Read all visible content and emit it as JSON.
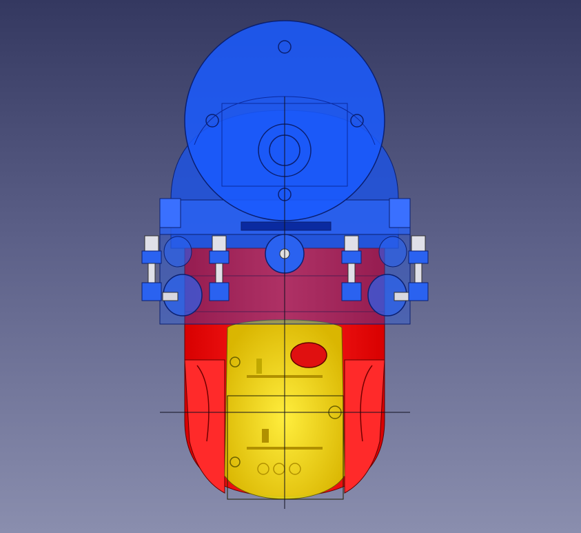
{
  "viewport": {
    "background_top": "#343860",
    "background_bottom": "#8a8eae",
    "view": "cad-3d-model-viewport"
  },
  "model": {
    "parts": [
      {
        "name": "top-cap",
        "color": "#1a5bff"
      },
      {
        "name": "upper-shell",
        "color": "#1a52e8"
      },
      {
        "name": "mount-ring",
        "color": "#2a62f0"
      },
      {
        "name": "body-shell",
        "color": "#ff1a1a"
      },
      {
        "name": "inner-sphere",
        "color": "#e8e800"
      },
      {
        "name": "screws",
        "color": "#d8d8e0"
      }
    ],
    "edge_color": "#101020"
  }
}
